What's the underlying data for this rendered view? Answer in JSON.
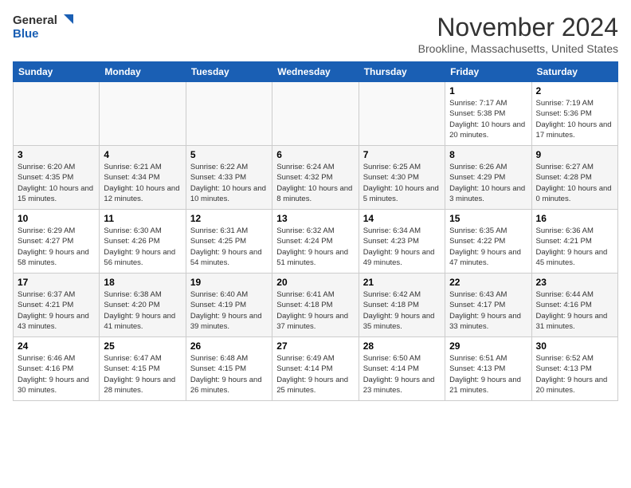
{
  "logo": {
    "line1": "General",
    "line2": "Blue"
  },
  "title": "November 2024",
  "subtitle": "Brookline, Massachusetts, United States",
  "days_of_week": [
    "Sunday",
    "Monday",
    "Tuesday",
    "Wednesday",
    "Thursday",
    "Friday",
    "Saturday"
  ],
  "weeks": [
    [
      {
        "day": "",
        "info": ""
      },
      {
        "day": "",
        "info": ""
      },
      {
        "day": "",
        "info": ""
      },
      {
        "day": "",
        "info": ""
      },
      {
        "day": "",
        "info": ""
      },
      {
        "day": "1",
        "info": "Sunrise: 7:17 AM\nSunset: 5:38 PM\nDaylight: 10 hours and 20 minutes."
      },
      {
        "day": "2",
        "info": "Sunrise: 7:19 AM\nSunset: 5:36 PM\nDaylight: 10 hours and 17 minutes."
      }
    ],
    [
      {
        "day": "3",
        "info": "Sunrise: 6:20 AM\nSunset: 4:35 PM\nDaylight: 10 hours and 15 minutes."
      },
      {
        "day": "4",
        "info": "Sunrise: 6:21 AM\nSunset: 4:34 PM\nDaylight: 10 hours and 12 minutes."
      },
      {
        "day": "5",
        "info": "Sunrise: 6:22 AM\nSunset: 4:33 PM\nDaylight: 10 hours and 10 minutes."
      },
      {
        "day": "6",
        "info": "Sunrise: 6:24 AM\nSunset: 4:32 PM\nDaylight: 10 hours and 8 minutes."
      },
      {
        "day": "7",
        "info": "Sunrise: 6:25 AM\nSunset: 4:30 PM\nDaylight: 10 hours and 5 minutes."
      },
      {
        "day": "8",
        "info": "Sunrise: 6:26 AM\nSunset: 4:29 PM\nDaylight: 10 hours and 3 minutes."
      },
      {
        "day": "9",
        "info": "Sunrise: 6:27 AM\nSunset: 4:28 PM\nDaylight: 10 hours and 0 minutes."
      }
    ],
    [
      {
        "day": "10",
        "info": "Sunrise: 6:29 AM\nSunset: 4:27 PM\nDaylight: 9 hours and 58 minutes."
      },
      {
        "day": "11",
        "info": "Sunrise: 6:30 AM\nSunset: 4:26 PM\nDaylight: 9 hours and 56 minutes."
      },
      {
        "day": "12",
        "info": "Sunrise: 6:31 AM\nSunset: 4:25 PM\nDaylight: 9 hours and 54 minutes."
      },
      {
        "day": "13",
        "info": "Sunrise: 6:32 AM\nSunset: 4:24 PM\nDaylight: 9 hours and 51 minutes."
      },
      {
        "day": "14",
        "info": "Sunrise: 6:34 AM\nSunset: 4:23 PM\nDaylight: 9 hours and 49 minutes."
      },
      {
        "day": "15",
        "info": "Sunrise: 6:35 AM\nSunset: 4:22 PM\nDaylight: 9 hours and 47 minutes."
      },
      {
        "day": "16",
        "info": "Sunrise: 6:36 AM\nSunset: 4:21 PM\nDaylight: 9 hours and 45 minutes."
      }
    ],
    [
      {
        "day": "17",
        "info": "Sunrise: 6:37 AM\nSunset: 4:21 PM\nDaylight: 9 hours and 43 minutes."
      },
      {
        "day": "18",
        "info": "Sunrise: 6:38 AM\nSunset: 4:20 PM\nDaylight: 9 hours and 41 minutes."
      },
      {
        "day": "19",
        "info": "Sunrise: 6:40 AM\nSunset: 4:19 PM\nDaylight: 9 hours and 39 minutes."
      },
      {
        "day": "20",
        "info": "Sunrise: 6:41 AM\nSunset: 4:18 PM\nDaylight: 9 hours and 37 minutes."
      },
      {
        "day": "21",
        "info": "Sunrise: 6:42 AM\nSunset: 4:18 PM\nDaylight: 9 hours and 35 minutes."
      },
      {
        "day": "22",
        "info": "Sunrise: 6:43 AM\nSunset: 4:17 PM\nDaylight: 9 hours and 33 minutes."
      },
      {
        "day": "23",
        "info": "Sunrise: 6:44 AM\nSunset: 4:16 PM\nDaylight: 9 hours and 31 minutes."
      }
    ],
    [
      {
        "day": "24",
        "info": "Sunrise: 6:46 AM\nSunset: 4:16 PM\nDaylight: 9 hours and 30 minutes."
      },
      {
        "day": "25",
        "info": "Sunrise: 6:47 AM\nSunset: 4:15 PM\nDaylight: 9 hours and 28 minutes."
      },
      {
        "day": "26",
        "info": "Sunrise: 6:48 AM\nSunset: 4:15 PM\nDaylight: 9 hours and 26 minutes."
      },
      {
        "day": "27",
        "info": "Sunrise: 6:49 AM\nSunset: 4:14 PM\nDaylight: 9 hours and 25 minutes."
      },
      {
        "day": "28",
        "info": "Sunrise: 6:50 AM\nSunset: 4:14 PM\nDaylight: 9 hours and 23 minutes."
      },
      {
        "day": "29",
        "info": "Sunrise: 6:51 AM\nSunset: 4:13 PM\nDaylight: 9 hours and 21 minutes."
      },
      {
        "day": "30",
        "info": "Sunrise: 6:52 AM\nSunset: 4:13 PM\nDaylight: 9 hours and 20 minutes."
      }
    ]
  ]
}
